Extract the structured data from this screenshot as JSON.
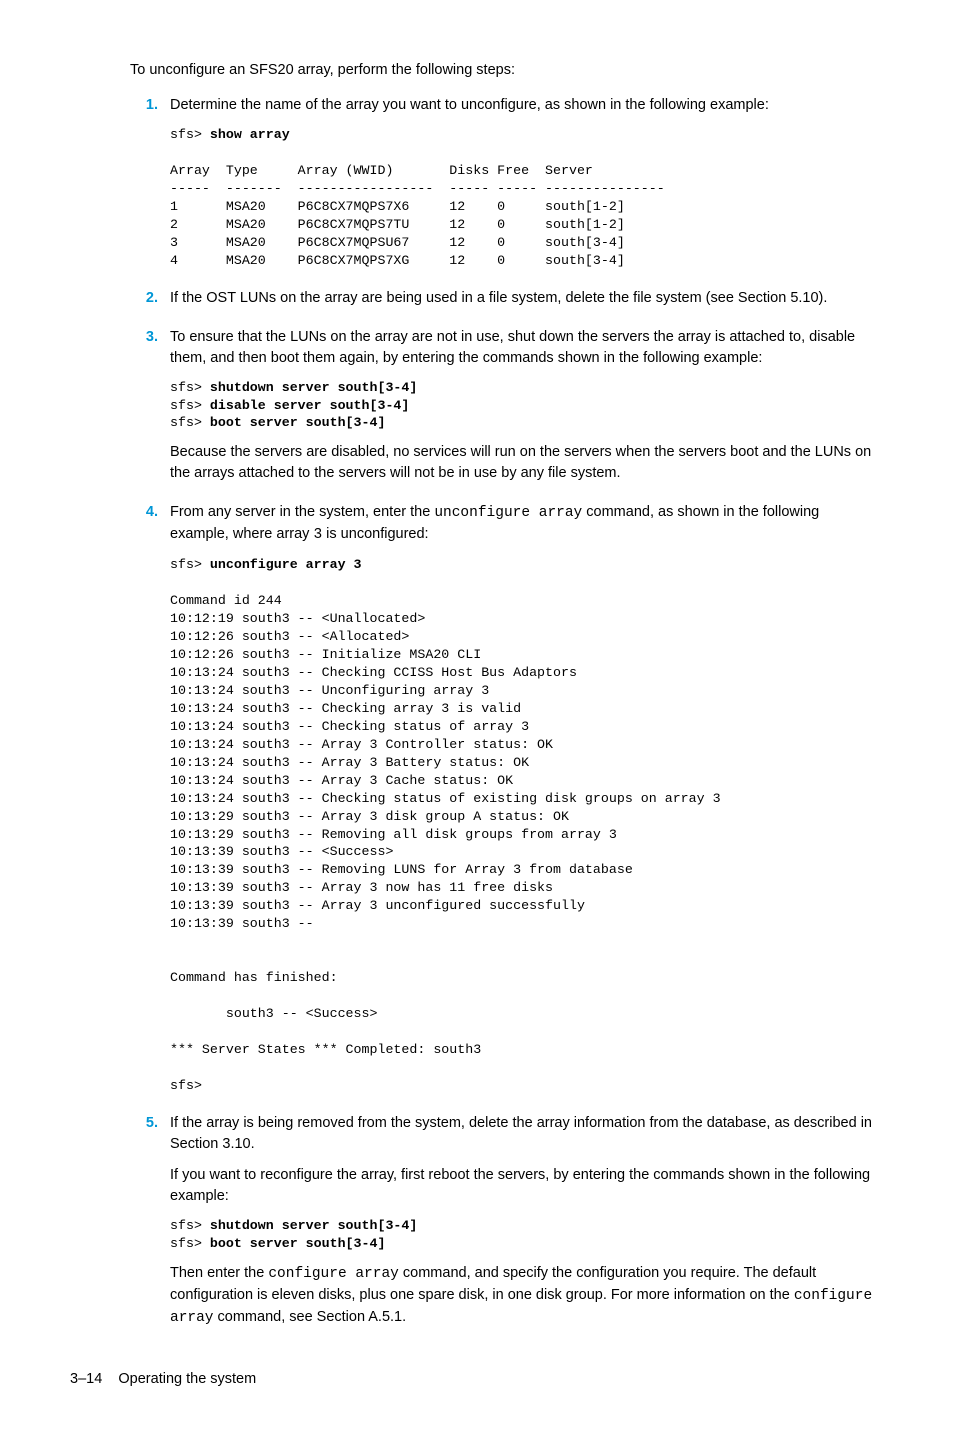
{
  "intro": "To unconfigure an SFS20 array, perform the following steps:",
  "steps": {
    "s1": {
      "num": "1.",
      "text": "Determine the name of the array you want to unconfigure, as shown in the following example:",
      "code_prompt": "sfs>",
      "code_cmd": "show array",
      "table": "Array  Type     Array (WWID)       Disks Free  Server\n-----  -------  -----------------  ----- ----- ---------------\n1      MSA20    P6C8CX7MQPS7X6     12    0     south[1-2]\n2      MSA20    P6C8CX7MQPS7TU     12    0     south[1-2]\n3      MSA20    P6C8CX7MQPSU67     12    0     south[3-4]\n4      MSA20    P6C8CX7MQPS7XG     12    0     south[3-4]"
    },
    "s2": {
      "num": "2.",
      "text": "If the OST LUNs on the array are being used in a file system, delete the file system (see Section 5.10)."
    },
    "s3": {
      "num": "3.",
      "text": "To ensure that the LUNs on the array are not in use, shut down the servers the array is attached to, disable them, and then boot them again, by entering the commands shown in the following example:",
      "code_l1_p": "sfs>",
      "code_l1_c": "shutdown server south[3-4]",
      "code_l2_p": "sfs>",
      "code_l2_c": "disable server south[3-4]",
      "code_l3_p": "sfs>",
      "code_l3_c": "boot server south[3-4]",
      "after": "Because the servers are disabled, no services will run on the servers when the servers boot and the LUNs on the arrays attached to the servers will not be in use by any file system."
    },
    "s4": {
      "num": "4.",
      "text_a": "From any server in the system, enter the ",
      "inline1": "unconfigure array",
      "text_b": " command, as shown in the following example, where array ",
      "inline2": "3",
      "text_c": " is unconfigured:",
      "code_prompt": "sfs>",
      "code_cmd": "unconfigure array 3",
      "output": "Command id 244\n10:12:19 south3 -- <Unallocated>\n10:12:26 south3 -- <Allocated>\n10:12:26 south3 -- Initialize MSA20 CLI\n10:13:24 south3 -- Checking CCISS Host Bus Adaptors\n10:13:24 south3 -- Unconfiguring array 3\n10:13:24 south3 -- Checking array 3 is valid\n10:13:24 south3 -- Checking status of array 3\n10:13:24 south3 -- Array 3 Controller status: OK\n10:13:24 south3 -- Array 3 Battery status: OK\n10:13:24 south3 -- Array 3 Cache status: OK\n10:13:24 south3 -- Checking status of existing disk groups on array 3\n10:13:29 south3 -- Array 3 disk group A status: OK\n10:13:29 south3 -- Removing all disk groups from array 3\n10:13:39 south3 -- <Success>\n10:13:39 south3 -- Removing LUNS for Array 3 from database\n10:13:39 south3 -- Array 3 now has 11 free disks\n10:13:39 south3 -- Array 3 unconfigured successfully\n10:13:39 south3 --\n\n\nCommand has finished:\n\n       south3 -- <Success>\n\n*** Server States *** Completed: south3\n\nsfs>"
    },
    "s5": {
      "num": "5.",
      "p1": "If the array is being removed from the system, delete the array information from the database, as described in Section 3.10.",
      "p2": "If you want to reconfigure the array, first reboot the servers, by entering the commands shown in the following example:",
      "code_l1_p": "sfs>",
      "code_l1_c": "shutdown server south[3-4]",
      "code_l2_p": "sfs>",
      "code_l2_c": "boot server south[3-4]",
      "p3a": "Then enter the ",
      "p3m1": "configure array",
      "p3b": " command, and specify the configuration you require. The default configuration is eleven disks, plus one spare disk, in one disk group. For more information on the ",
      "p3m2": "configure array",
      "p3c": " command, see Section A.5.1."
    }
  },
  "footer": {
    "page": "3–14",
    "title": "Operating the system"
  }
}
